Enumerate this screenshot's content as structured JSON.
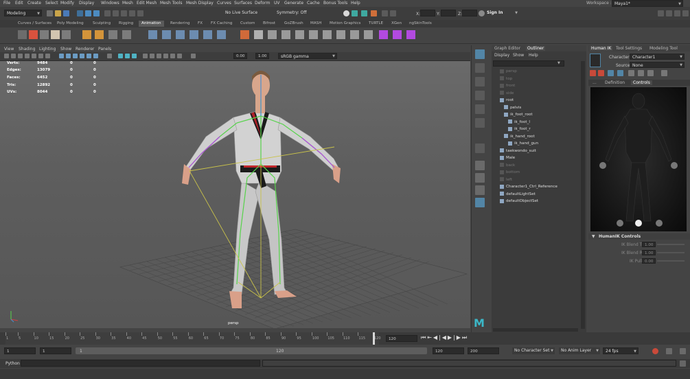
{
  "menus": [
    "File",
    "Edit",
    "Create",
    "Select",
    "Modify",
    "Display",
    "Windows",
    "Mesh",
    "Edit Mesh",
    "Mesh Tools",
    "Mesh Display",
    "Curves",
    "Surfaces",
    "Deform",
    "UV",
    "Generate",
    "Cache",
    "Bonus Tools",
    "Help"
  ],
  "workspace": {
    "label": "Workspace :",
    "value": "Maya1*"
  },
  "toolbar": {
    "mode": "Modeling",
    "live_surface": "No Live Surface",
    "symmetry": "Symmetry: Off",
    "sign_in": "Sign In",
    "x_label": "X:",
    "y_label": "Y:",
    "z_label": "Z:"
  },
  "shelf_tabs": [
    "Curves / Surfaces",
    "Poly Modeling",
    "Sculpting",
    "Rigging",
    "Animation",
    "Rendering",
    "FX",
    "FX Caching",
    "Custom",
    "Bifrost",
    "GoZBrush",
    "MASH",
    "Motion Graphics",
    "TURTLE",
    "XGen",
    "ngSkinTools"
  ],
  "shelf_active": "Animation",
  "viewport_menu": [
    "View",
    "Shading",
    "Lighting",
    "Show",
    "Renderer",
    "Panels"
  ],
  "viewport_toolbar": {
    "exposure": "0.00",
    "gamma": "1.00",
    "color_space": "sRGB gamma"
  },
  "hud": [
    {
      "label": "Verts:",
      "v1": "9484",
      "v2": "0",
      "v3": "0"
    },
    {
      "label": "Edges:",
      "v1": "13079",
      "v2": "0",
      "v3": "0"
    },
    {
      "label": "Faces:",
      "v1": "6452",
      "v2": "0",
      "v3": "0"
    },
    {
      "label": "Tris:",
      "v1": "12892",
      "v2": "0",
      "v3": "0"
    },
    {
      "label": "UVs:",
      "v1": "8044",
      "v2": "0",
      "v3": "0"
    }
  ],
  "camera_label": "persp",
  "outliner": {
    "tabs": [
      "Graph Editor",
      "Outliner"
    ],
    "menu": [
      "Display",
      "Show",
      "Help"
    ],
    "items": [
      {
        "label": "persp",
        "indent": 0,
        "dim": true
      },
      {
        "label": "top",
        "indent": 0,
        "dim": true
      },
      {
        "label": "front",
        "indent": 0,
        "dim": true
      },
      {
        "label": "side",
        "indent": 0,
        "dim": true
      },
      {
        "label": "root",
        "indent": 0,
        "dim": false
      },
      {
        "label": "pelvis",
        "indent": 1,
        "dim": false
      },
      {
        "label": "ik_foot_root",
        "indent": 1,
        "dim": false
      },
      {
        "label": "ik_foot_l",
        "indent": 2,
        "dim": false
      },
      {
        "label": "ik_foot_r",
        "indent": 2,
        "dim": false
      },
      {
        "label": "ik_hand_root",
        "indent": 1,
        "dim": false
      },
      {
        "label": "ik_hand_gun",
        "indent": 2,
        "dim": false
      },
      {
        "label": "taekwondo_suit",
        "indent": 0,
        "dim": false
      },
      {
        "label": "Male",
        "indent": 0,
        "dim": false
      },
      {
        "label": "back",
        "indent": 0,
        "dim": true
      },
      {
        "label": "bottom",
        "indent": 0,
        "dim": true
      },
      {
        "label": "left",
        "indent": 0,
        "dim": true
      },
      {
        "label": "Character1_Ctrl_Reference",
        "indent": 0,
        "dim": false
      },
      {
        "label": "defaultLightSet",
        "indent": 0,
        "dim": false
      },
      {
        "label": "defaultObjectSet",
        "indent": 0,
        "dim": false
      }
    ]
  },
  "humanik": {
    "tabs": [
      "Human IK",
      "Tool Settings",
      "Modeling Tool"
    ],
    "character_label": "Character:",
    "character_value": "Character1",
    "source_label": "Source:",
    "source_value": "None",
    "subtabs": [
      "...",
      "Definition",
      "Controls"
    ],
    "controls_header": "HumanIK Controls",
    "params": [
      {
        "label": "IK Blend T",
        "value": "1.00"
      },
      {
        "label": "IK Blend R",
        "value": "1.00"
      },
      {
        "label": "IK Pull",
        "value": "0.00"
      }
    ]
  },
  "timeline": {
    "ticks": [
      "1",
      "5",
      "10",
      "15",
      "20",
      "25",
      "30",
      "35",
      "40",
      "45",
      "50",
      "55",
      "60",
      "65",
      "70",
      "75",
      "80",
      "85",
      "90",
      "95",
      "100",
      "105",
      "110",
      "115",
      "120"
    ],
    "current": "120",
    "current_field": "120",
    "playhead": 120,
    "start": 1,
    "end": 120
  },
  "range": {
    "start": "1",
    "start2": "1",
    "range_end": "120",
    "end": "120",
    "end2": "200",
    "range_start_label": "1"
  },
  "status": {
    "no_char_set": "No Character Set",
    "no_anim_layer": "No Anim Layer",
    "fps": "24 fps"
  },
  "python_label": "Python",
  "colors": {
    "accent": "#5285a6",
    "bone_green": "#56d34a",
    "bone_purple": "#b24adf",
    "ik_yellow": "#c9c24a",
    "selected_blue": "#4a8fd3"
  }
}
